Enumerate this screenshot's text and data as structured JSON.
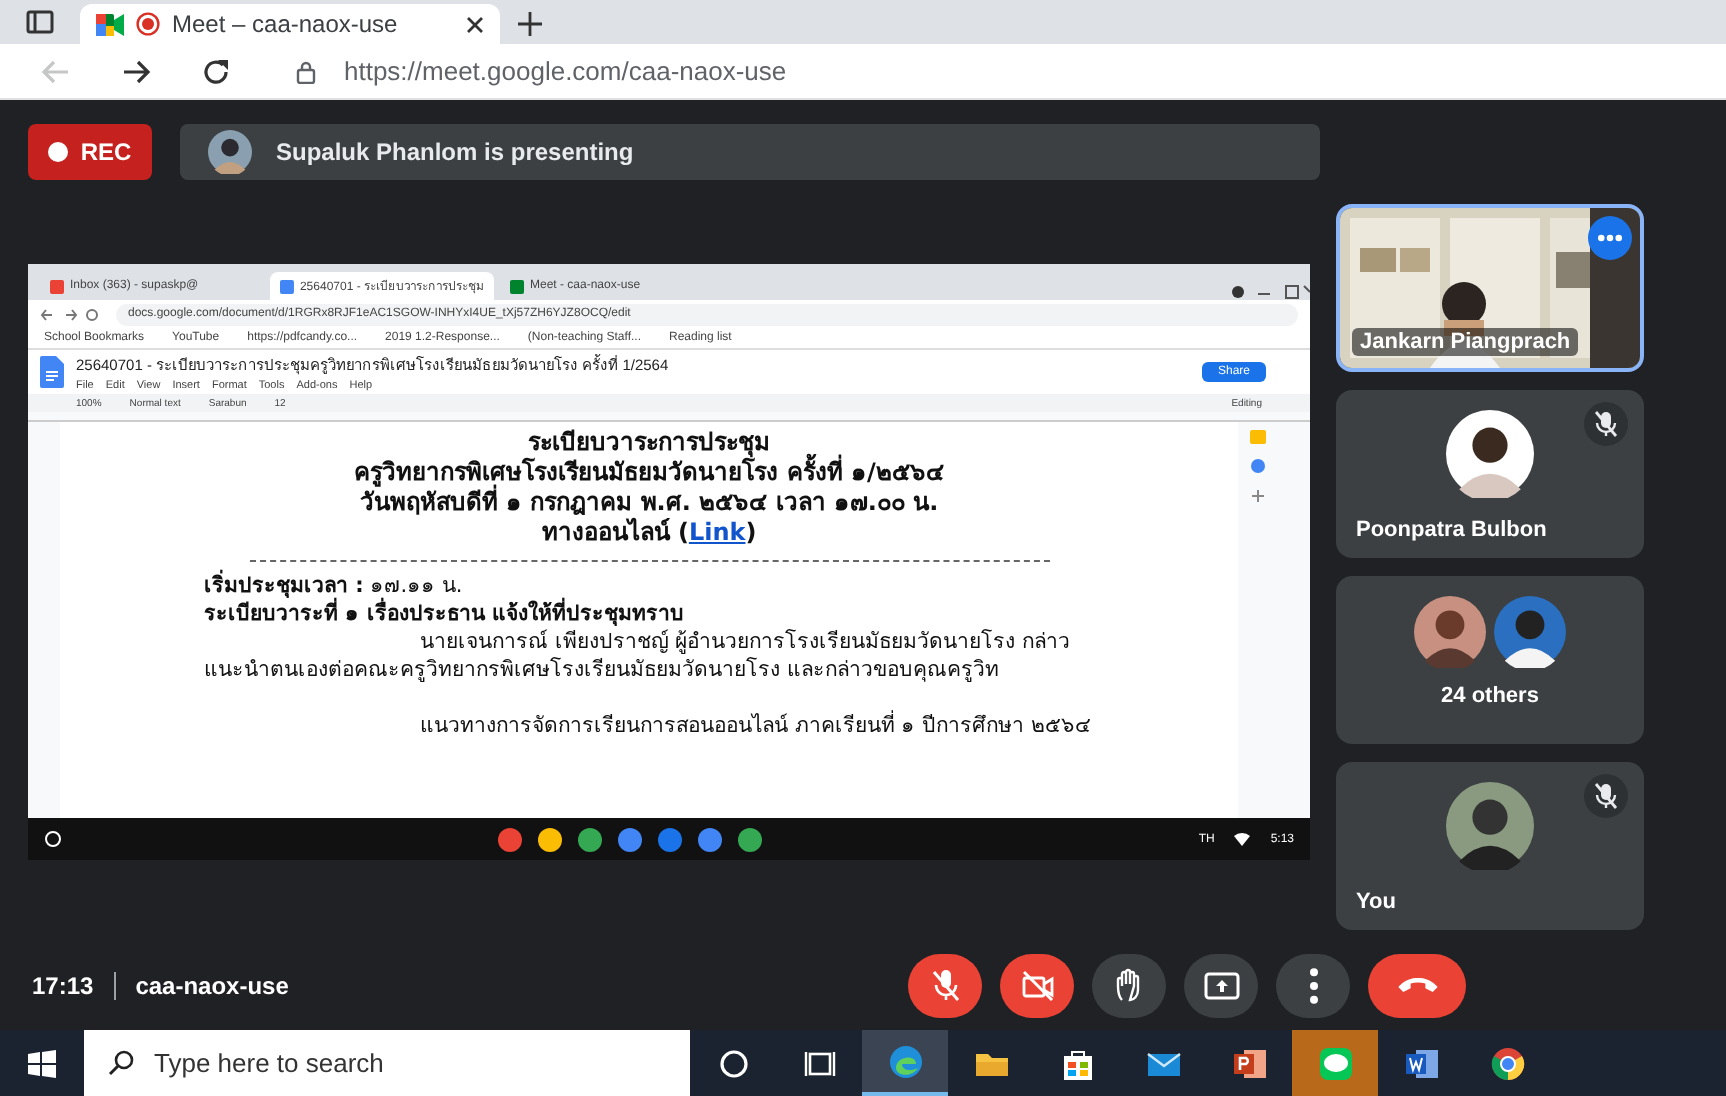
{
  "browser": {
    "tabs": [
      {
        "label": "Meet – caa-naox-use",
        "selected": true,
        "recording": true
      }
    ],
    "nav": [
      {
        "kind": "back",
        "disabled": true
      },
      {
        "kind": "forward",
        "disabled": false
      },
      {
        "kind": "reload",
        "disabled": false
      }
    ],
    "url": "https://meet.google.com/caa-naox-use"
  },
  "meet": {
    "rec_label": "REC",
    "presenter": "Supaluk Phanlom is presenting",
    "shared_screen": {
      "tabs": [
        {
          "label": "Inbox (363) - supaskp@",
          "selected": false
        },
        {
          "label": "25640701 - ระเบียบวาระการประชุม",
          "selected": true
        },
        {
          "label": "Meet - caa-naox-use",
          "selected": false
        }
      ],
      "url": "docs.google.com/document/d/1RGRx8RJF1eAC1SGOW-INHYxI4UE_tXj57ZH6YJZ8OCQ/edit",
      "bookmarks": [
        "School Bookmarks",
        "YouTube",
        "https://pdfcandy.co...",
        "2019 1.2-Response...",
        "(Non-teaching Staff...",
        "Reading list"
      ],
      "doc_title": "25640701 - ระเบียบวาระการประชุมครูวิทยากรพิเศษโรงเรียนมัธยมวัดนายโรง ครั้งที่ 1/2564",
      "menus": [
        "File",
        "Edit",
        "View",
        "Insert",
        "Format",
        "Tools",
        "Add-ons",
        "Help"
      ],
      "share_label": "Share",
      "toolbar": {
        "zoom": "100%",
        "style": "Normal text",
        "font": "Sarabun",
        "size": "12",
        "mode": "Editing"
      },
      "heading": [
        "ระเบียบวาระการประชุม",
        "ครูวิทยากรพิเศษโรงเรียนมัธยมวัดนายโรง ครั้งที่ ๑/๒๕๖๔",
        "วันพฤหัสบดีที่ ๑ กรกฎาคม  พ.ศ. ๒๕๖๔ เวลา ๑๗.๐๐ น."
      ],
      "online_line": {
        "text": "ทางออนไลน์ (",
        "link": "Link",
        "after": ")"
      },
      "body": [
        {
          "text": "**เริ่มประชุมเวลา :**  ๑๗.๑๑  น.",
          "kind": "rich",
          "indent": false,
          "space_before": false
        },
        {
          "text": "ระเบียบวาระที่ ๑ เรื่องประธาน แจ้งให้ที่ประชุมทราบ",
          "kind": "bold",
          "indent": false,
          "space_before": false
        },
        {
          "text": "นายเจนการณ์ เพียงปราชญ์ ผู้อำนวยการโรงเรียนมัธยมวัดนายโรง กล่าว",
          "kind": "plain",
          "indent": true,
          "space_before": false
        },
        {
          "text": "แนะนำตนเองต่อคณะครูวิทยากรพิเศษโรงเรียนมัธยมวัดนายโรง และกล่าวขอบคุณครูวิท",
          "kind": "plain",
          "indent": false,
          "space_before": false
        },
        {
          "text": "แนวทางการจัดการเรียนการสอนออนไลน์ ภาคเรียนที่ ๑ ปีการศึกษา ๒๕๖๔",
          "kind": "plain",
          "indent": true,
          "space_before": true
        }
      ],
      "shelf": {
        "language": "TH",
        "time": "5:13"
      }
    },
    "participants": [
      {
        "name": "Jankarn Piangprach",
        "kind": "video",
        "muted": false,
        "speaking": true
      },
      {
        "name": "Poonpatra Bulbon",
        "kind": "avatar",
        "muted": true,
        "speaking": false
      },
      {
        "name": "24 others",
        "kind": "group",
        "muted": false,
        "speaking": false
      },
      {
        "name": "You",
        "muted": true,
        "speaking": false
      }
    ],
    "meeting_time": "17:13",
    "meeting_code": "caa-naox-use",
    "controls": [
      {
        "kind": "mic",
        "off": true
      },
      {
        "kind": "camera",
        "off": true
      },
      {
        "kind": "hand",
        "off": false
      },
      {
        "kind": "present",
        "off": false
      },
      {
        "kind": "more",
        "off": false
      },
      {
        "kind": "leave"
      }
    ]
  },
  "taskbar": {
    "search": {
      "placeholder": "Type here to search"
    },
    "apps": [
      {
        "kind": "cortana",
        "active": false,
        "flashing": false
      },
      {
        "kind": "taskview",
        "active": false,
        "flashing": false
      },
      {
        "kind": "edge",
        "active": true,
        "flashing": false
      },
      {
        "kind": "explorer",
        "active": false,
        "flashing": false
      },
      {
        "kind": "store",
        "active": false,
        "flashing": false
      },
      {
        "kind": "mail",
        "active": false,
        "flashing": false
      },
      {
        "kind": "powerpoint",
        "active": false,
        "flashing": false
      },
      {
        "kind": "line",
        "active": false,
        "flashing": true
      },
      {
        "kind": "word",
        "active": false,
        "flashing": false
      },
      {
        "kind": "chrome",
        "active": false,
        "flashing": false
      }
    ]
  }
}
